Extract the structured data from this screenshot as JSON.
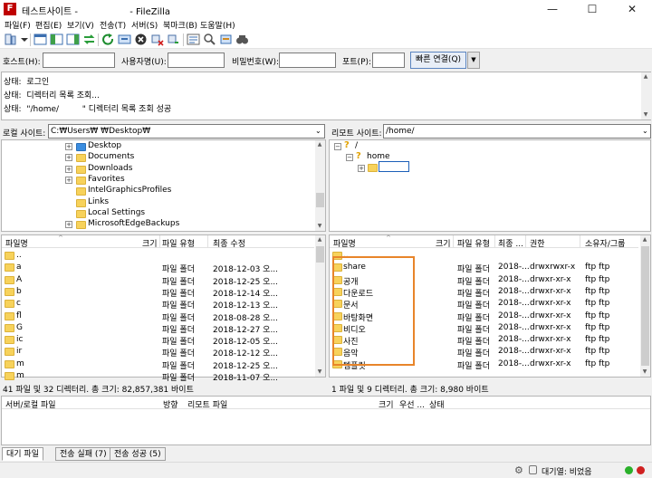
{
  "window": {
    "title": "테스트사이트 -                  - FileZilla",
    "app_icon_letter": "F",
    "minimize": "—",
    "maximize": "☐",
    "close": "✕"
  },
  "menu": [
    "파일(F)",
    "편집(E)",
    "보기(V)",
    "전송(T)",
    "서버(S)",
    "북마크(B)",
    "도움말(H)"
  ],
  "quickconnect": {
    "host_label": "호스트(H):",
    "user_label": "사용자명(U):",
    "pass_label": "비밀번호(W):",
    "port_label": "포트(P):",
    "host_value": "",
    "user_value": "",
    "pass_value": "",
    "port_value": "",
    "connect_button": "빠른 연결(Q)",
    "dropdown": "▼"
  },
  "log": [
    "상태:  로그인",
    "상태:  디렉터리 목록 조회...",
    "상태:  \"/home/         \" 디렉터리 목록 조회 성공"
  ],
  "local_site": {
    "label": "로컬 사이트:",
    "path": "C:₩Users₩            ₩Desktop₩"
  },
  "remote_site": {
    "label": "리모트 사이트:",
    "path": "/home/"
  },
  "local_tree": [
    {
      "name": "Desktop",
      "expander": "+",
      "kind": "desktop"
    },
    {
      "name": "Documents",
      "expander": "+",
      "kind": "docs"
    },
    {
      "name": "Downloads",
      "expander": "+",
      "kind": "download"
    },
    {
      "name": "Favorites",
      "expander": "+",
      "kind": "folder"
    },
    {
      "name": "IntelGraphicsProfiles",
      "expander": "",
      "kind": "folder"
    },
    {
      "name": "Links",
      "expander": "",
      "kind": "folder"
    },
    {
      "name": "Local Settings",
      "expander": "",
      "kind": "folder"
    },
    {
      "name": "MicrosoftEdgeBackups",
      "expander": "+",
      "kind": "folder"
    }
  ],
  "remote_tree": {
    "root": "/",
    "home": "home",
    "root_expander": "−",
    "home_expander": "−",
    "child_expander": "+"
  },
  "local_list": {
    "headers": {
      "name": "파일명",
      "size": "크기",
      "type": "파일 유형",
      "modified": "최종 수정"
    },
    "rows": [
      {
        "name": "..",
        "type": "",
        "modified": ""
      },
      {
        "name": "a",
        "type": "파일 폴더",
        "modified": "2018-12-03 오..."
      },
      {
        "name": "A",
        "type": "파일 폴더",
        "modified": "2018-12-25 오..."
      },
      {
        "name": "b",
        "type": "파일 폴더",
        "modified": "2018-12-14 오..."
      },
      {
        "name": "c",
        "type": "파일 폴더",
        "modified": "2018-12-13 오..."
      },
      {
        "name": "fl",
        "type": "파일 폴더",
        "modified": "2018-08-28 오..."
      },
      {
        "name": "G",
        "type": "파일 폴더",
        "modified": "2018-12-27 오..."
      },
      {
        "name": "ic",
        "type": "파일 폴더",
        "modified": "2018-12-05 오..."
      },
      {
        "name": "ir",
        "type": "파일 폴더",
        "modified": "2018-12-12 오..."
      },
      {
        "name": "m",
        "type": "파일 폴더",
        "modified": "2018-12-25 오..."
      },
      {
        "name": "m",
        "type": "파일 폴더",
        "modified": "2018-11-07 오..."
      }
    ],
    "status": "41 파일 및 32 디렉터리. 총 크기: 82,857,381 바이트"
  },
  "remote_list": {
    "headers": {
      "name": "파일명",
      "size": "크기",
      "type": "파일 유형",
      "modified": "최종 ...",
      "perm": "권한",
      "owner": "소유자/그룹"
    },
    "rows": [
      {
        "name": "..",
        "type": "",
        "modified": "",
        "perm": "",
        "owner": ""
      },
      {
        "name": "share",
        "type": "파일 폴더",
        "modified": "2018-...",
        "perm": "drwxrwxr-x",
        "owner": "ftp ftp"
      },
      {
        "name": "공개",
        "type": "파일 폴더",
        "modified": "2018-...",
        "perm": "drwxr-xr-x",
        "owner": "ftp ftp"
      },
      {
        "name": "다운로드",
        "type": "파일 폴더",
        "modified": "2018-...",
        "perm": "drwxr-xr-x",
        "owner": "ftp ftp"
      },
      {
        "name": "문서",
        "type": "파일 폴더",
        "modified": "2018-...",
        "perm": "drwxr-xr-x",
        "owner": "ftp ftp"
      },
      {
        "name": "바탕화면",
        "type": "파일 폴더",
        "modified": "2018-...",
        "perm": "drwxr-xr-x",
        "owner": "ftp ftp"
      },
      {
        "name": "비디오",
        "type": "파일 폴더",
        "modified": "2018-...",
        "perm": "drwxr-xr-x",
        "owner": "ftp ftp"
      },
      {
        "name": "사진",
        "type": "파일 폴더",
        "modified": "2018-...",
        "perm": "drwxr-xr-x",
        "owner": "ftp ftp"
      },
      {
        "name": "음악",
        "type": "파일 폴더",
        "modified": "2018-...",
        "perm": "drwxr-xr-x",
        "owner": "ftp ftp"
      },
      {
        "name": "템플릿",
        "type": "파일 폴더",
        "modified": "2018-...",
        "perm": "drwxr-xr-x",
        "owner": "ftp ftp"
      }
    ],
    "status": "1 파일 및 9 디렉터리. 총 크기: 8,980 바이트"
  },
  "queue": {
    "headers": {
      "server_file": "서버/로컬 파일",
      "direction": "방향",
      "remote_file": "리모트 파일",
      "size": "크기",
      "priority": "우선 ...",
      "status": "상태"
    }
  },
  "tabs": {
    "queued": "대기 파일",
    "failed": "전송 실패 (7)",
    "success": "전송 성공 (5)"
  },
  "statusbar": {
    "queue": "대기열: 비었음"
  },
  "colors": {
    "highlight": "#e8852a",
    "folder": "#f7d25b",
    "accent": "#5a84c0",
    "status_green": "#2ab02a",
    "status_red": "#d02020"
  }
}
